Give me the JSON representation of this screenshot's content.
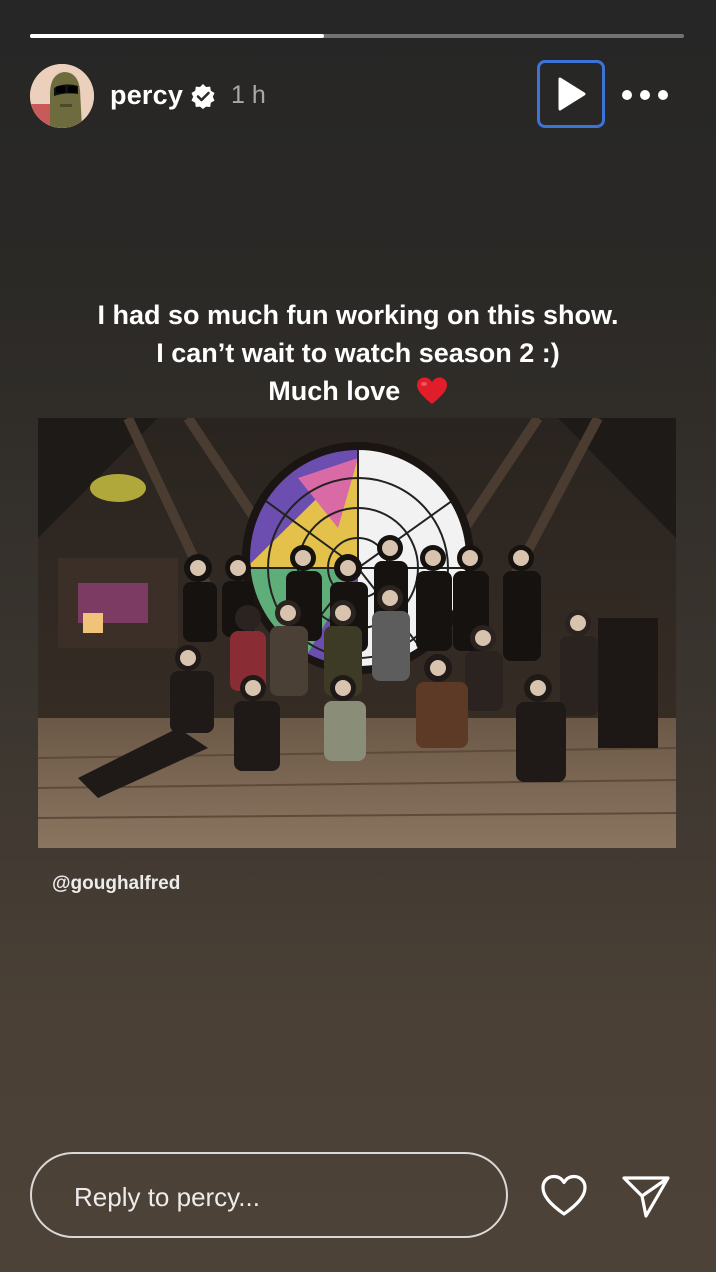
{
  "story": {
    "progress": 0.45,
    "username": "percy",
    "verified": true,
    "time_ago": "1 h",
    "play_icon": "play-icon",
    "more_icon": "more-icon"
  },
  "caption": {
    "line1": "I had so much fun working on this show.",
    "line2": "I can’t wait to watch season 2 :)",
    "line3": "Much love",
    "emoji": "❤️"
  },
  "photo": {
    "credit": "@goughalfred"
  },
  "footer": {
    "reply_placeholder": "Reply to percy...",
    "like_icon": "heart-icon",
    "share_icon": "send-icon"
  },
  "colors": {
    "focus_outline": "#3b73d6",
    "heart": "#e11d2a"
  }
}
